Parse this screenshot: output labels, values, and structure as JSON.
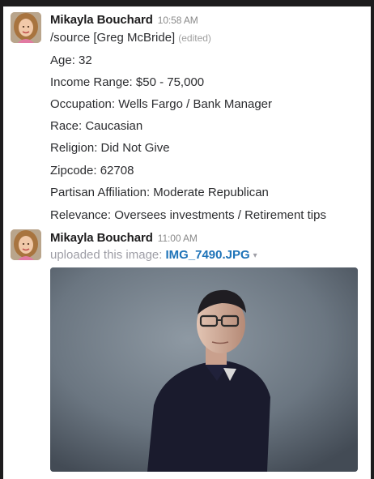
{
  "messages": [
    {
      "author": "Mikayla Bouchard",
      "time": "10:58 AM",
      "source_line": "/source [Greg McBride]",
      "edited": "(edited)",
      "details": [
        "Age: 32",
        "Income Range: $50 - 75,000",
        "Occupation: Wells Fargo / Bank Manager",
        "Race: Caucasian",
        "Religion: Did Not Give",
        "Zipcode: 62708",
        "Partisan Affiliation: Moderate Republican",
        "Relevance: Oversees investments / Retirement tips"
      ]
    },
    {
      "author": "Mikayla Bouchard",
      "time": "11:00 AM",
      "upload_text": "uploaded this image:",
      "file_name": "IMG_7490.JPG",
      "caret": "▾"
    }
  ],
  "colors": {
    "link": "#1e73b8",
    "muted": "#9e9ea6",
    "text": "#2c2d30",
    "outer_bg": "#1d1c1d"
  },
  "icons": {
    "avatar": "user-avatar-photo",
    "dropdown": "chevron-down-icon"
  }
}
